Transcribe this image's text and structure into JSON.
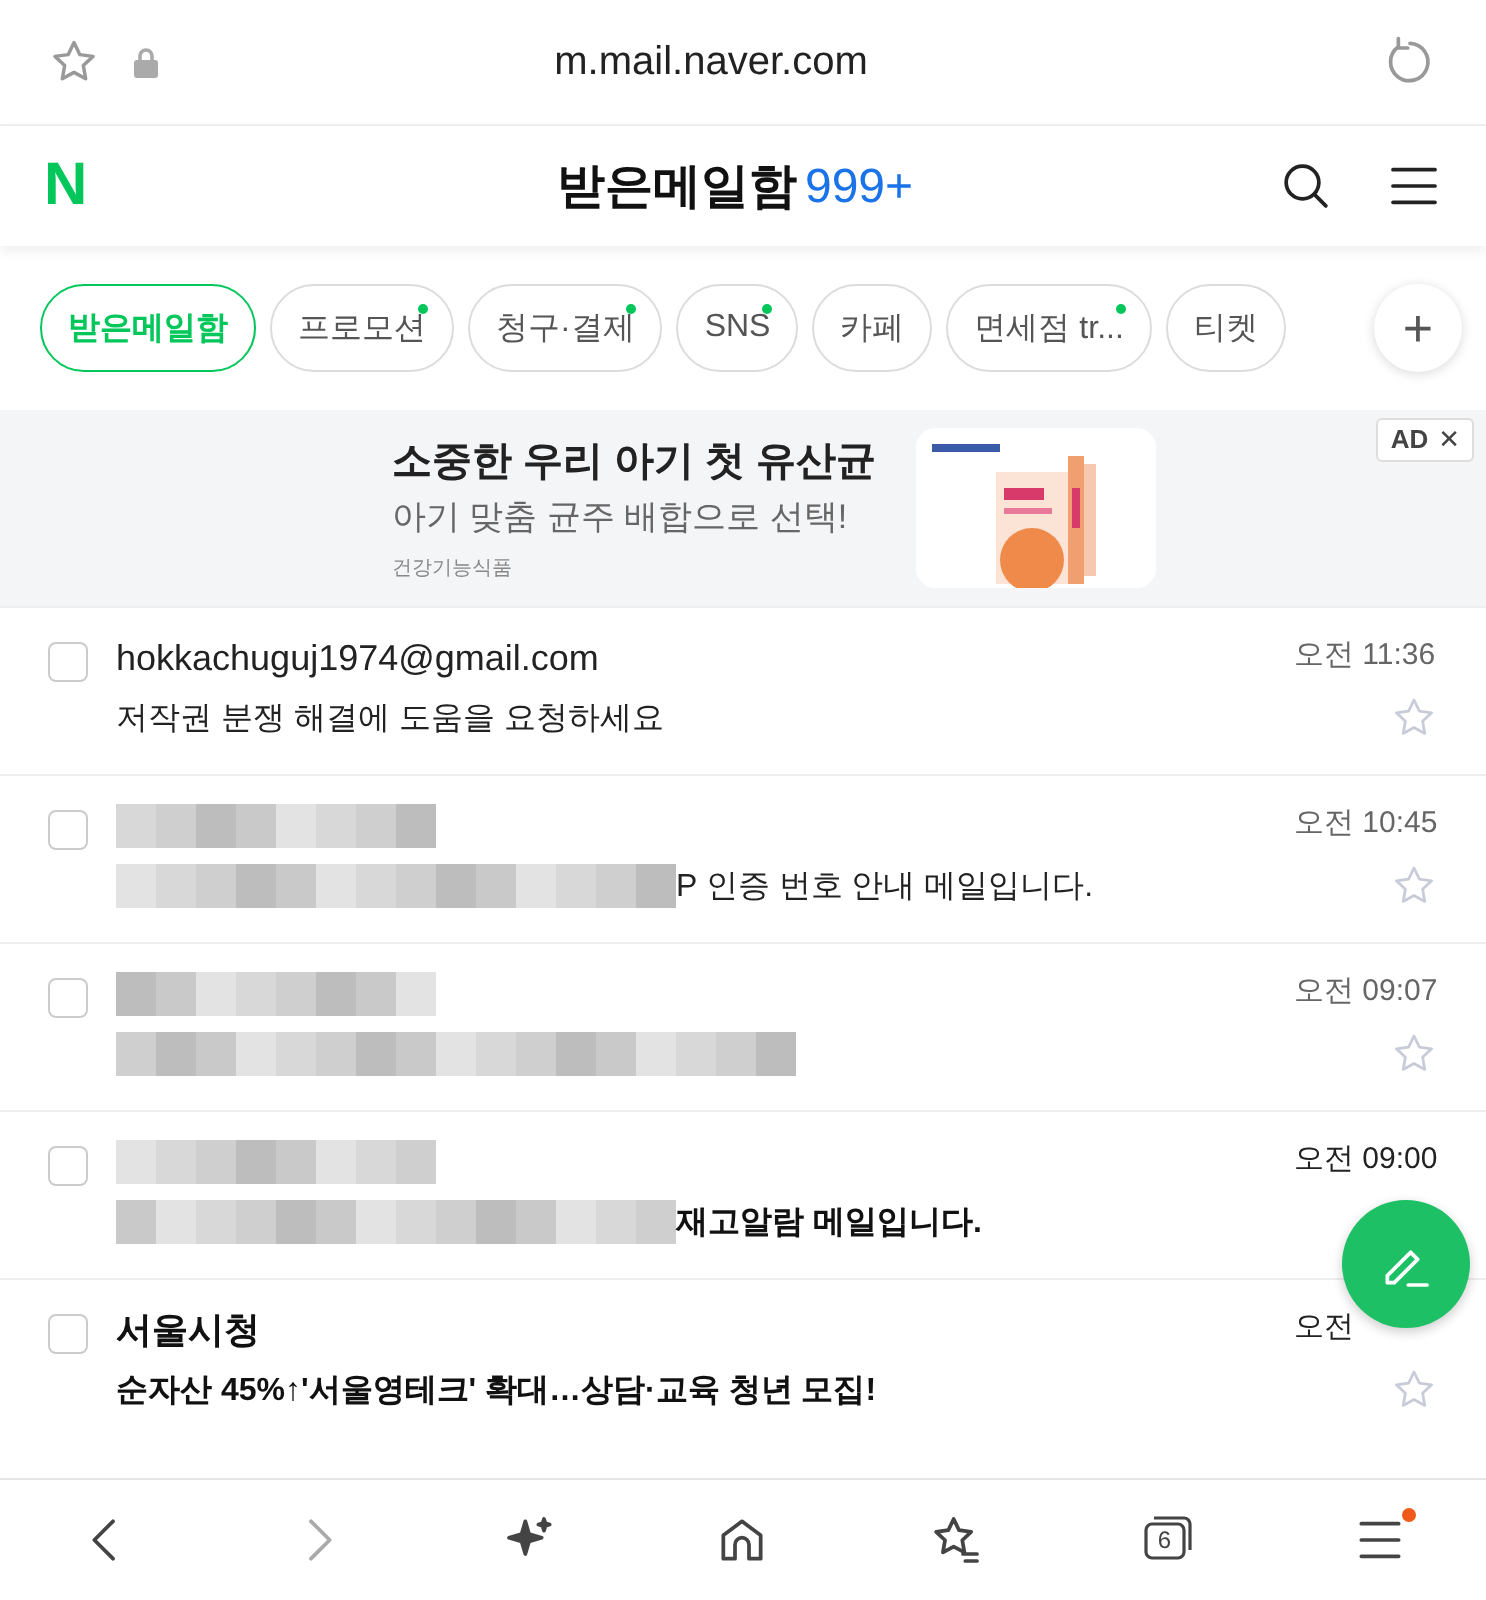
{
  "address_bar": {
    "url": "m.mail.naver.com"
  },
  "header": {
    "logo": "N",
    "title": "받은메일함",
    "count": "999+"
  },
  "tabs": [
    {
      "label": "받은메일함",
      "selected": true,
      "new": false
    },
    {
      "label": "프로모션",
      "selected": false,
      "new": true
    },
    {
      "label": "청구·결제",
      "selected": false,
      "new": true
    },
    {
      "label": "SNS",
      "selected": false,
      "new": true
    },
    {
      "label": "카페",
      "selected": false,
      "new": false
    },
    {
      "label": "면세점 tr...",
      "selected": false,
      "new": true
    },
    {
      "label": "티켓",
      "selected": false,
      "new": false
    }
  ],
  "tab_add": "+",
  "ad": {
    "title": "소중한 우리 아기 첫 유산균",
    "subtitle": "아기 맞춤 균주 배합으로 선택!",
    "category": "건강기능식품",
    "badge": "AD",
    "close": "✕"
  },
  "mails": [
    {
      "sender": "hokkachuguj1974@gmail.com",
      "subject": "저작권 분쟁 해결에 도움을 요청하세요",
      "time": "오전 11:36",
      "unread": false,
      "blurred": false,
      "starred": false,
      "checked": false
    },
    {
      "subject": "P 인증 번호 안내 메일입니다.",
      "time": "오전 10:45",
      "unread": false,
      "blurred": true,
      "starred": false,
      "checked": false
    },
    {
      "time": "오전 09:07",
      "unread": false,
      "blurred": true,
      "starred": false,
      "checked": false
    },
    {
      "subject": "재고알람 메일입니다.",
      "time": "오전 09:00",
      "unread": true,
      "blurred": true,
      "checked": false
    },
    {
      "sender": "서울시청",
      "subject": "순자산 45%↑'서울영테크' 확대…상담·교육 청년 모집!",
      "time": "오전",
      "unread": true,
      "blurred": false,
      "starred": false,
      "checked": false
    }
  ],
  "bottom_nav": {
    "tab_count": "6",
    "menu_badge": true
  }
}
